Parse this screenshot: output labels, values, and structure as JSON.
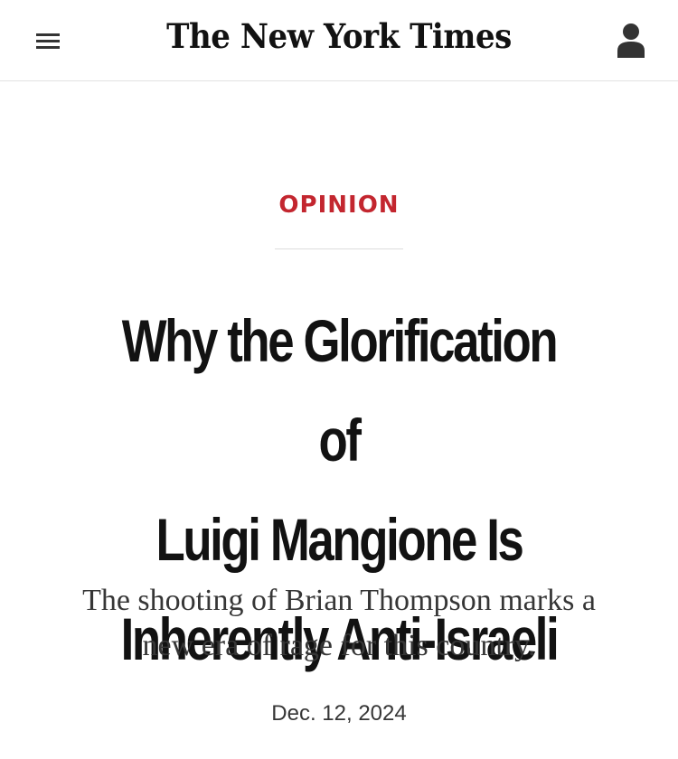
{
  "header": {
    "logo": "The New York Times",
    "menu_icon": "hamburger-menu-icon",
    "account_icon": "user-account-icon"
  },
  "article": {
    "section": "OPINION",
    "headline": "Why the Glorification of\nLuigi Mangione Is\nInherently Anti-Israeli",
    "summary": "The shooting of Brian Thompson marks a\nnew era of rage for this country.",
    "date": "Dec. 12, 2024"
  },
  "colors": {
    "section_red": "#c3262f",
    "text": "#121212",
    "summary_text": "#363636"
  }
}
